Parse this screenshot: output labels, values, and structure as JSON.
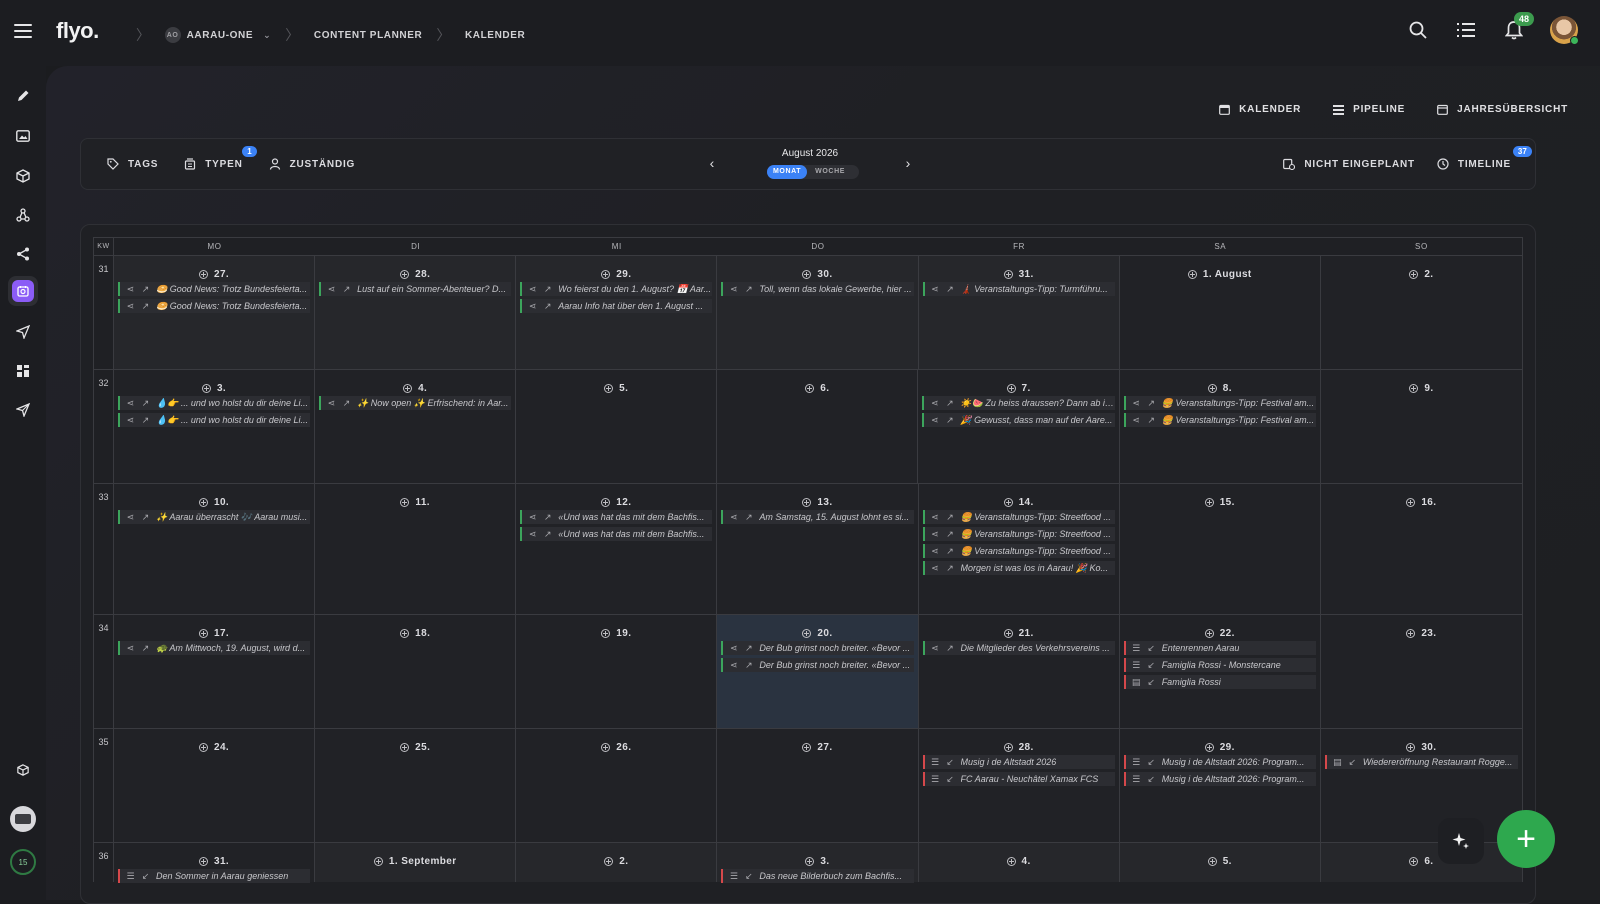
{
  "app": {
    "logo": "flyo."
  },
  "breadcrumbs": [
    {
      "badge": "AO",
      "label": "AARAU-ONE",
      "has_caret": true
    },
    {
      "label": "CONTENT PLANNER"
    },
    {
      "label": "KALENDER"
    }
  ],
  "header": {
    "notification_count": "48"
  },
  "views": [
    {
      "icon": "calendar-icon",
      "label": "KALENDER"
    },
    {
      "icon": "pipeline-icon",
      "label": "PIPELINE"
    },
    {
      "icon": "year-calendar-icon",
      "label": "JAHRESÜBERSICHT"
    }
  ],
  "toolbar": {
    "tags_label": "TAGS",
    "types_label": "TYPEN",
    "types_badge": "1",
    "assignee_label": "ZUSTÄNDIG",
    "month_title": "August 2026",
    "mode_month": "MONAT",
    "mode_week": "WOCHE",
    "unplanned_label": "NICHT EINGEPLANT",
    "timeline_label": "TIMELINE",
    "timeline_badge": "37"
  },
  "calendar": {
    "kw_label": "KW",
    "weekdays": [
      "MO",
      "DI",
      "MI",
      "DO",
      "FR",
      "SA",
      "SO"
    ],
    "weeks": [
      {
        "kw": "31",
        "days": [
          {
            "label": "27.",
            "dim": true,
            "events": [
              {
                "color": "green",
                "icons": [
                  "share",
                  "out"
                ],
                "text": "🥯 Good News: Trotz Bundesfeierta..."
              },
              {
                "color": "green",
                "icons": [
                  "share",
                  "out"
                ],
                "text": "🥯 Good News: Trotz Bundesfeierta..."
              }
            ]
          },
          {
            "label": "28.",
            "dim": true,
            "events": [
              {
                "color": "green",
                "icons": [
                  "share",
                  "out"
                ],
                "text": "Lust auf ein Sommer-Abenteuer? D..."
              }
            ]
          },
          {
            "label": "29.",
            "dim": true,
            "events": [
              {
                "color": "green",
                "icons": [
                  "share",
                  "out"
                ],
                "text": "Wo feierst du den 1. August? 📅 Aar..."
              },
              {
                "color": "green",
                "icons": [
                  "share",
                  "out"
                ],
                "text": "Aarau Info hat über den 1. August ..."
              }
            ]
          },
          {
            "label": "30.",
            "dim": true,
            "events": [
              {
                "color": "green",
                "icons": [
                  "share",
                  "out"
                ],
                "text": "Toll, wenn das lokale Gewerbe, hier ..."
              }
            ]
          },
          {
            "label": "31.",
            "dim": true,
            "events": [
              {
                "color": "green",
                "icons": [
                  "share",
                  "out"
                ],
                "text": "🗼 Veranstaltungs-Tipp: Turmführu..."
              }
            ]
          },
          {
            "label": "1. August",
            "events": []
          },
          {
            "label": "2.",
            "events": []
          }
        ]
      },
      {
        "kw": "32",
        "days": [
          {
            "label": "3.",
            "events": [
              {
                "color": "green",
                "icons": [
                  "share",
                  "out"
                ],
                "text": "💧👉 ... und wo holst du dir deine Li..."
              },
              {
                "color": "green",
                "icons": [
                  "share",
                  "out"
                ],
                "text": "💧👉 ... und wo holst du dir deine Li..."
              }
            ]
          },
          {
            "label": "4.",
            "events": [
              {
                "color": "green",
                "icons": [
                  "share",
                  "out"
                ],
                "text": "✨ Now open ✨ Erfrischend: in Aar..."
              }
            ]
          },
          {
            "label": "5.",
            "events": []
          },
          {
            "label": "6.",
            "events": []
          },
          {
            "label": "7.",
            "events": [
              {
                "color": "green",
                "icons": [
                  "share",
                  "out"
                ],
                "text": "☀️🍉 Zu heiss draussen? Dann ab in..."
              },
              {
                "color": "green",
                "icons": [
                  "share",
                  "out"
                ],
                "text": "🎉 Gewusst, dass man auf der Aare..."
              }
            ]
          },
          {
            "label": "8.",
            "events": [
              {
                "color": "green",
                "icons": [
                  "share",
                  "out"
                ],
                "text": "🍔 Veranstaltungs-Tipp: Festival am..."
              },
              {
                "color": "green",
                "icons": [
                  "share",
                  "out"
                ],
                "text": "🍔 Veranstaltungs-Tipp: Festival am..."
              }
            ]
          },
          {
            "label": "9.",
            "events": []
          }
        ]
      },
      {
        "kw": "33",
        "days": [
          {
            "label": "10.",
            "events": [
              {
                "color": "green",
                "icons": [
                  "share",
                  "out"
                ],
                "text": "✨ Aarau überrascht 🎶 Aarau musi..."
              }
            ]
          },
          {
            "label": "11.",
            "events": []
          },
          {
            "label": "12.",
            "events": [
              {
                "color": "green",
                "icons": [
                  "share",
                  "out"
                ],
                "text": "«Und was hat das mit dem Bachfis..."
              },
              {
                "color": "green",
                "icons": [
                  "share",
                  "out"
                ],
                "text": "«Und was hat das mit dem Bachfis..."
              }
            ]
          },
          {
            "label": "13.",
            "events": [
              {
                "color": "green",
                "icons": [
                  "share",
                  "out"
                ],
                "text": "Am Samstag, 15. August lohnt es si..."
              }
            ]
          },
          {
            "label": "14.",
            "events": [
              {
                "color": "green",
                "icons": [
                  "share",
                  "out"
                ],
                "text": "🍔 Veranstaltungs-Tipp: Streetfood ..."
              },
              {
                "color": "green",
                "icons": [
                  "share",
                  "out"
                ],
                "text": "🍔 Veranstaltungs-Tipp: Streetfood ..."
              },
              {
                "color": "green",
                "icons": [
                  "share",
                  "out"
                ],
                "text": "🍔 Veranstaltungs-Tipp: Streetfood ..."
              },
              {
                "color": "green",
                "icons": [
                  "share",
                  "out"
                ],
                "text": "Morgen ist was los in Aarau! 🎉 Ko..."
              }
            ]
          },
          {
            "label": "15.",
            "events": []
          },
          {
            "label": "16.",
            "events": []
          }
        ]
      },
      {
        "kw": "34",
        "days": [
          {
            "label": "17.",
            "events": [
              {
                "color": "green",
                "icons": [
                  "share",
                  "out"
                ],
                "text": "🐢 Am Mittwoch, 19. August, wird d..."
              }
            ]
          },
          {
            "label": "18.",
            "events": []
          },
          {
            "label": "19.",
            "events": []
          },
          {
            "label": "20.",
            "today": true,
            "events": [
              {
                "color": "green",
                "icons": [
                  "share",
                  "out"
                ],
                "text": "Der Bub grinst noch breiter. «Bevor ..."
              },
              {
                "color": "green",
                "icons": [
                  "share",
                  "out"
                ],
                "text": "Der Bub grinst noch breiter. «Bevor ..."
              }
            ]
          },
          {
            "label": "21.",
            "events": [
              {
                "color": "green",
                "icons": [
                  "share",
                  "out"
                ],
                "text": "Die Mitglieder des Verkehrsvereins ..."
              }
            ]
          },
          {
            "label": "22.",
            "events": [
              {
                "color": "red",
                "icons": [
                  "list",
                  "in"
                ],
                "text": "Entenrennen Aarau"
              },
              {
                "color": "red",
                "icons": [
                  "list",
                  "in"
                ],
                "text": "Famiglia Rossi - Monstercane"
              },
              {
                "color": "red",
                "icons": [
                  "doc",
                  "in"
                ],
                "text": "Famiglia Rossi"
              }
            ]
          },
          {
            "label": "23.",
            "events": []
          }
        ]
      },
      {
        "kw": "35",
        "days": [
          {
            "label": "24.",
            "events": []
          },
          {
            "label": "25.",
            "events": []
          },
          {
            "label": "26.",
            "events": []
          },
          {
            "label": "27.",
            "events": []
          },
          {
            "label": "28.",
            "events": [
              {
                "color": "red",
                "icons": [
                  "list",
                  "in"
                ],
                "text": "Musig i de Altstadt 2026"
              },
              {
                "color": "red",
                "icons": [
                  "list",
                  "in"
                ],
                "text": "FC Aarau - Neuchâtel Xamax FCS"
              }
            ]
          },
          {
            "label": "29.",
            "events": [
              {
                "color": "red",
                "icons": [
                  "list",
                  "in"
                ],
                "text": "Musig i de Altstadt 2026: Program..."
              },
              {
                "color": "red",
                "icons": [
                  "list",
                  "in"
                ],
                "text": "Musig i de Altstadt 2026: Program..."
              }
            ]
          },
          {
            "label": "30.",
            "events": [
              {
                "color": "red",
                "icons": [
                  "doc",
                  "in"
                ],
                "text": "Wiedereröffnung Restaurant Rogge..."
              }
            ]
          }
        ]
      },
      {
        "kw": "36",
        "days": [
          {
            "label": "31.",
            "events": [
              {
                "color": "red",
                "icons": [
                  "list",
                  "in"
                ],
                "text": "Den Sommer in Aarau geniessen"
              }
            ]
          },
          {
            "label": "1. September",
            "dim": true,
            "events": []
          },
          {
            "label": "2.",
            "dim": true,
            "events": []
          },
          {
            "label": "3.",
            "dim": true,
            "events": [
              {
                "color": "red",
                "icons": [
                  "list",
                  "in"
                ],
                "text": "Das neue Bilderbuch zum Bachfis..."
              }
            ]
          },
          {
            "label": "4.",
            "dim": true,
            "events": []
          },
          {
            "label": "5.",
            "dim": true,
            "events": []
          },
          {
            "label": "6.",
            "dim": true,
            "events": []
          }
        ]
      }
    ]
  },
  "sidebar": {
    "items": [
      {
        "icon": "pencil-icon"
      },
      {
        "icon": "folder-image-icon"
      },
      {
        "icon": "cube-icon"
      },
      {
        "icon": "network-icon"
      },
      {
        "icon": "share-icon"
      },
      {
        "icon": "planner-icon",
        "active": true
      },
      {
        "icon": "send-icon"
      },
      {
        "icon": "dashboard-icon"
      },
      {
        "icon": "paper-plane-icon"
      }
    ],
    "bottom_badge": "15"
  },
  "fab": {
    "add_label": "+"
  }
}
